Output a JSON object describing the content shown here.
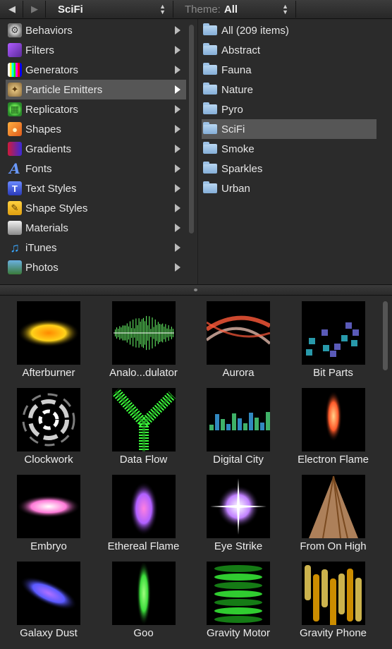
{
  "toolbar": {
    "back_glyph": "◀",
    "forward_glyph": "▶",
    "path_value": "SciFi",
    "theme_label": "Theme:",
    "theme_value": "All"
  },
  "categories": [
    {
      "label": "Behaviors",
      "icon": "gear-icon"
    },
    {
      "label": "Filters",
      "icon": "filter-icon"
    },
    {
      "label": "Generators",
      "icon": "color-bars-icon"
    },
    {
      "label": "Particle Emitters",
      "icon": "particle-emitter-icon"
    },
    {
      "label": "Replicators",
      "icon": "replicator-icon"
    },
    {
      "label": "Shapes",
      "icon": "shapes-icon"
    },
    {
      "label": "Gradients",
      "icon": "gradient-icon"
    },
    {
      "label": "Fonts",
      "icon": "font-icon"
    },
    {
      "label": "Text Styles",
      "icon": "text-style-icon"
    },
    {
      "label": "Shape Styles",
      "icon": "shape-style-icon"
    },
    {
      "label": "Materials",
      "icon": "material-icon"
    },
    {
      "label": "iTunes",
      "icon": "music-note-icon"
    },
    {
      "label": "Photos",
      "icon": "photos-icon"
    }
  ],
  "selected_category": "Particle Emitters",
  "folders": [
    "All (209 items)",
    "Abstract",
    "Fauna",
    "Nature",
    "Pyro",
    "SciFi",
    "Smoke",
    "Sparkles",
    "Urban"
  ],
  "selected_folder": "SciFi",
  "items": [
    {
      "label": "Afterburner",
      "colors": [
        "#ffd21a",
        "#ff8a00"
      ]
    },
    {
      "label": "Analo...dulator",
      "colors": [
        "#6cff6c",
        "#ffffff"
      ]
    },
    {
      "label": "Aurora",
      "colors": [
        "#ff5a3a",
        "#ffd0c0"
      ]
    },
    {
      "label": "Bit Parts",
      "colors": [
        "#6a6ad8",
        "#2fb4c8"
      ]
    },
    {
      "label": "Clockwork",
      "colors": [
        "#cfcfcf",
        "#ffffff"
      ]
    },
    {
      "label": "Data Flow",
      "colors": [
        "#3cff3c",
        "#1a8a1a"
      ]
    },
    {
      "label": "Digital City",
      "colors": [
        "#3aa0e0",
        "#4ad07a"
      ]
    },
    {
      "label": "Electron Flame",
      "colors": [
        "#ff5a2a",
        "#ffd38a"
      ]
    },
    {
      "label": "Embryo",
      "colors": [
        "#ff7ad8",
        "#ffffff"
      ]
    },
    {
      "label": "Ethereal Flame",
      "colors": [
        "#b060ff",
        "#ff80e0"
      ]
    },
    {
      "label": "Eye Strike",
      "colors": [
        "#c080ff",
        "#ffffff"
      ]
    },
    {
      "label": "From On High",
      "colors": [
        "#d8a070",
        "#7a4a20"
      ]
    },
    {
      "label": "Galaxy Dust",
      "colors": [
        "#5a5aff",
        "#b070ff"
      ]
    },
    {
      "label": "Goo",
      "colors": [
        "#3cdc3c",
        "#a0ff80"
      ]
    },
    {
      "label": "Gravity Motor",
      "colors": [
        "#3cff3c",
        "#1a9a1a"
      ]
    },
    {
      "label": "Gravity Phone",
      "colors": [
        "#ffb000",
        "#ffe060"
      ]
    }
  ]
}
